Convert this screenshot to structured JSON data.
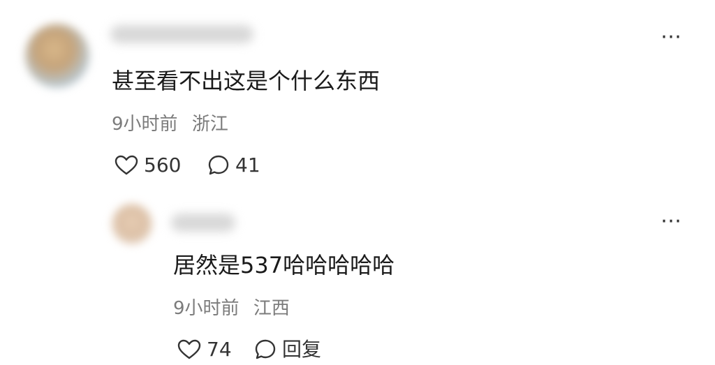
{
  "comments": [
    {
      "text": "甚至看不出这是个什么东西",
      "time": "9小时前",
      "location": "浙江",
      "likes": "560",
      "replies": "41",
      "icons": {
        "more": "more-icon",
        "like": "heart-icon",
        "reply": "comment-bubble-icon"
      }
    },
    {
      "text": "居然是537哈哈哈哈哈",
      "time": "9小时前",
      "location": "江西",
      "likes": "74",
      "reply_label": "回复",
      "icons": {
        "more": "more-icon",
        "like": "heart-icon",
        "reply": "comment-bubble-icon"
      }
    }
  ],
  "colors": {
    "text": "#1a1a1a",
    "meta": "#7b7b7b",
    "icon": "#333333",
    "background": "#ffffff"
  }
}
